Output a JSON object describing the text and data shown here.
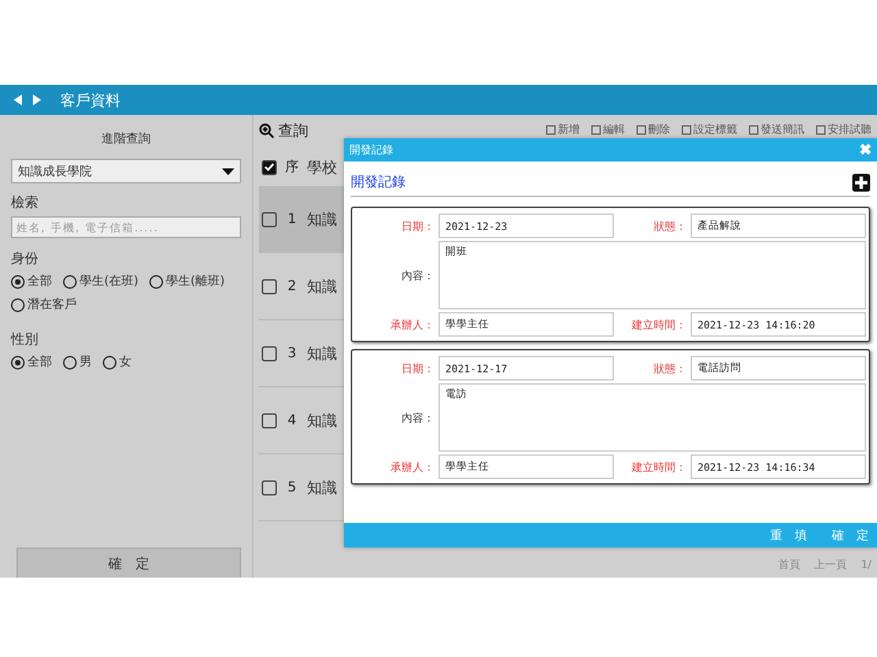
{
  "header": {
    "title": "客戶資料"
  },
  "sidebar": {
    "title": "進階查詢",
    "select": "知識成長學院",
    "search_label": "檢索",
    "search_placeholder": "姓名, 手機, 電子信箱.....",
    "groups": [
      {
        "label": "身份",
        "options": [
          {
            "label": "全部",
            "selected": true
          },
          {
            "label": "學生(在班)",
            "selected": false
          },
          {
            "label": "學生(離班)",
            "selected": false
          },
          {
            "label": "潛在客戶",
            "selected": false
          }
        ]
      },
      {
        "label": "性別",
        "options": [
          {
            "label": "全部",
            "selected": true
          },
          {
            "label": "男",
            "selected": false
          },
          {
            "label": "女",
            "selected": false
          }
        ]
      }
    ],
    "confirm": "確　定"
  },
  "main": {
    "query": "查詢",
    "toolbar": [
      "新增",
      "編輯",
      "刪除",
      "設定標籤",
      "發送簡訊",
      "安排試聽"
    ],
    "table": {
      "all_checked": true,
      "columns": [
        "序",
        "學校"
      ],
      "rows": [
        {
          "index": "1",
          "school": "知識",
          "selected": true,
          "checked": false
        },
        {
          "index": "2",
          "school": "知識",
          "selected": false,
          "checked": false
        },
        {
          "index": "3",
          "school": "知識",
          "selected": false,
          "checked": false
        },
        {
          "index": "4",
          "school": "知識",
          "selected": false,
          "checked": false
        },
        {
          "index": "5",
          "school": "知識",
          "selected": false,
          "checked": false
        }
      ]
    },
    "pager": [
      "首頁",
      "上一頁",
      "1/"
    ]
  },
  "modal": {
    "title": "開發記錄",
    "heading": "開發記錄",
    "close": "✖",
    "records": [
      {
        "date_label": "日期：",
        "date": "2021-12-23",
        "status_label": "狀態：",
        "status": "產品解說",
        "content_label": "內容：",
        "content": "開班",
        "owner_label": "承辦人：",
        "owner": "學學主任",
        "created_label": "建立時間：",
        "created": "2021-12-23 14:16:20"
      },
      {
        "date_label": "日期：",
        "date": "2021-12-17",
        "status_label": "狀態：",
        "status": "電話訪問",
        "content_label": "內容：",
        "content": "電訪",
        "owner_label": "承辦人：",
        "owner": "學學主任",
        "created_label": "建立時間：",
        "created": "2021-12-23 14:16:34"
      }
    ],
    "buttons": [
      "重　填",
      "確　定"
    ]
  }
}
